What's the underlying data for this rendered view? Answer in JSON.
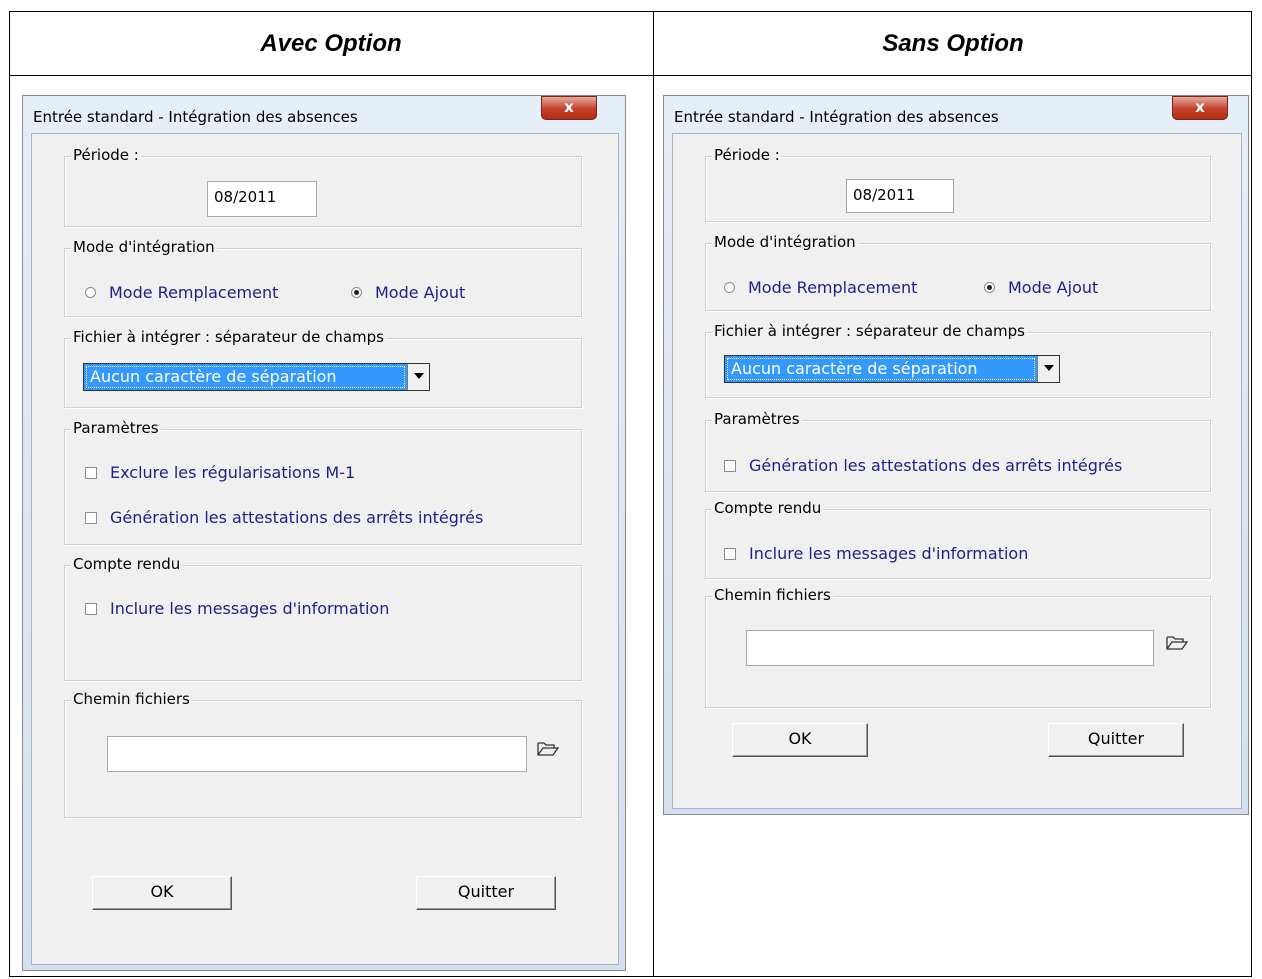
{
  "columns": {
    "left_title": "Avec Option",
    "right_title": "Sans Option"
  },
  "dialog": {
    "title": "Entrée standard - Intégration des absences",
    "close_label": "x",
    "periode_label": "Période :",
    "periode_value": "08/2011",
    "mode_label": "Mode d'intégration",
    "mode_remplacement": "Mode Remplacement",
    "mode_ajout": "Mode Ajout",
    "mode_selected": "Mode Ajout",
    "fichier_label": "Fichier à intégrer : séparateur de champs",
    "separateur_value": "Aucun caractère de séparation",
    "parametres_label": "Paramètres",
    "exclure_label": "Exclure les régularisations M-1",
    "generation_label": "Génération les attestations des arrêts intégrés",
    "compte_rendu_label": "Compte rendu",
    "inclure_label": "Inclure les messages d'information",
    "chemin_label": "Chemin fichiers",
    "chemin_value": "",
    "ok_label": "OK",
    "quitter_label": "Quitter"
  },
  "icons": {
    "close": "close-icon",
    "folder": "folder-icon",
    "dropdown": "chevron-down-icon"
  },
  "colors": {
    "selection": "#3399ff",
    "option_text": "#1f1f8a",
    "close_button": "#c4402a"
  }
}
